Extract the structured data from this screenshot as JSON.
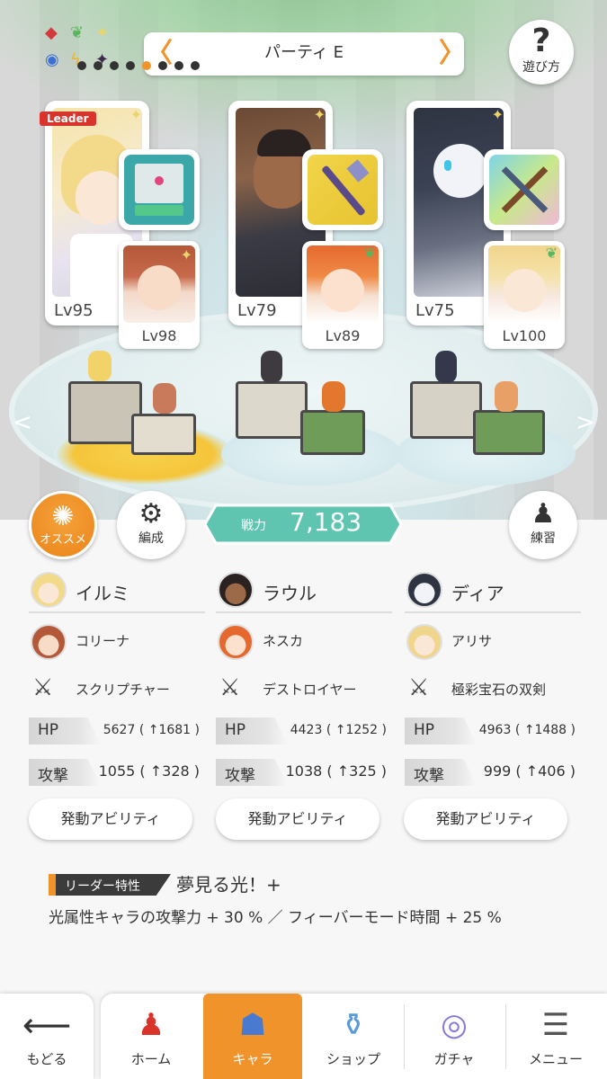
{
  "header": {
    "party_title": "パーティ E",
    "help_label": "遊び方",
    "page_dots_total": 8,
    "page_dots_active_index": 4
  },
  "cards": [
    {
      "leader_label": "Leader",
      "main_level": "Lv95",
      "sub_level": "Lv98",
      "weapon_icon": "book-icon",
      "sub_badge": "sparkle-icon"
    },
    {
      "leader_label": "",
      "main_level": "Lv79",
      "sub_level": "Lv89",
      "weapon_icon": "spear-icon",
      "sub_badge": "leaf-icon"
    },
    {
      "leader_label": "",
      "main_level": "Lv75",
      "sub_level": "Lv100",
      "weapon_icon": "twin-swords-icon",
      "sub_badge": "leaf-icon"
    }
  ],
  "actions": {
    "osusume_label": "オススメ",
    "hensei_label": "編成",
    "practice_label": "練習",
    "power_label": "戦力",
    "power_value": "7,183"
  },
  "columns": [
    {
      "main_name": "イルミ",
      "sub_name": "コリーナ",
      "weapon_name": "スクリプチャー",
      "hp_label": "HP",
      "hp_value": "5627 ( ↑1681 )",
      "atk_label": "攻撃",
      "atk_value": "1055 ( ↑328 )",
      "ability_label": "発動アビリティ"
    },
    {
      "main_name": "ラウル",
      "sub_name": "ネスカ",
      "weapon_name": "デストロイヤー",
      "hp_label": "HP",
      "hp_value": "4423 ( ↑1252 )",
      "atk_label": "攻撃",
      "atk_value": "1038 ( ↑325 )",
      "ability_label": "発動アビリティ"
    },
    {
      "main_name": "ディア",
      "sub_name": "アリサ",
      "weapon_name": "極彩宝石の双剣",
      "hp_label": "HP",
      "hp_value": "4963 ( ↑1488 )",
      "atk_label": "攻撃",
      "atk_value": "999 ( ↑406 )",
      "ability_label": "発動アビリティ"
    }
  ],
  "leader": {
    "tag": "リーダー特性",
    "skill_name": "夢見る光！+",
    "description": "光属性キャラの攻撃力 + 30 % ／ フィーバーモード時間 + 25 %"
  },
  "nav": {
    "back": "もどる",
    "home": "ホーム",
    "chara": "キャラ",
    "shop": "ショップ",
    "gacha": "ガチャ",
    "menu": "メニュー"
  },
  "colors": {
    "accent": "#f0932b",
    "power_box": "#5fc5b0",
    "leader_badge": "#d9342b"
  }
}
